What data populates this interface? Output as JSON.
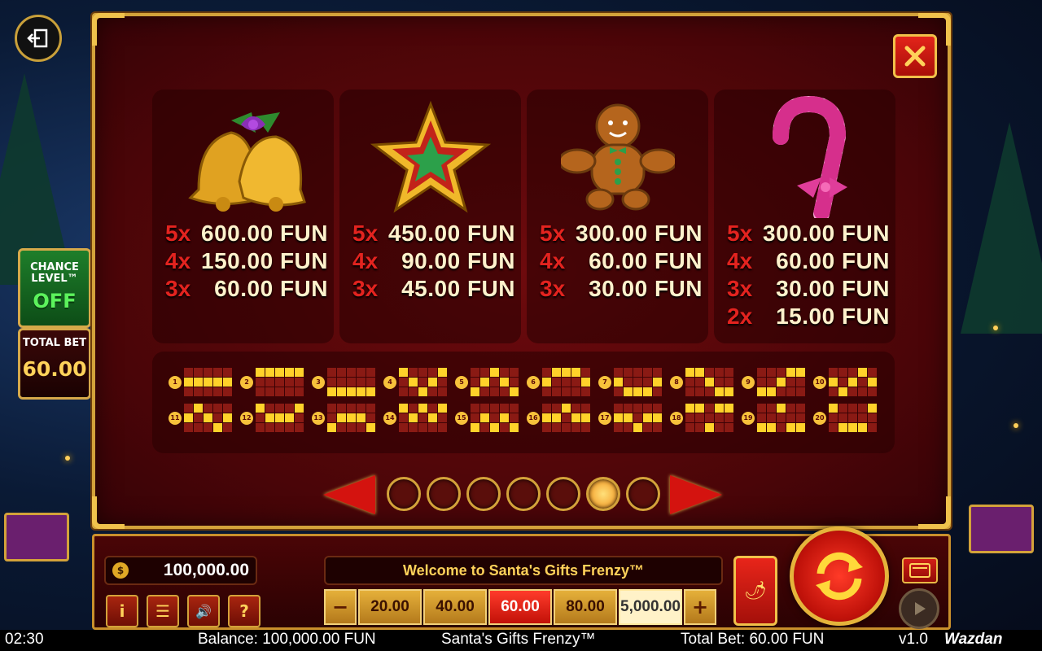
{
  "side": {
    "chance_label": "CHANCE LEVEL™",
    "chance_value": "OFF",
    "total_bet_label": "TOTAL BET",
    "total_bet_value": "60.00"
  },
  "paytable": {
    "symbols": [
      {
        "name": "bells",
        "icon": "bells-icon",
        "pays": [
          {
            "count": "5x",
            "amount": "600.00 FUN"
          },
          {
            "count": "4x",
            "amount": "150.00 FUN"
          },
          {
            "count": "3x",
            "amount": "60.00 FUN"
          }
        ]
      },
      {
        "name": "star",
        "icon": "star-icon",
        "pays": [
          {
            "count": "5x",
            "amount": "450.00 FUN"
          },
          {
            "count": "4x",
            "amount": "90.00 FUN"
          },
          {
            "count": "3x",
            "amount": "45.00 FUN"
          }
        ]
      },
      {
        "name": "gingerbread",
        "icon": "gingerbread-man-icon",
        "pays": [
          {
            "count": "5x",
            "amount": "300.00 FUN"
          },
          {
            "count": "4x",
            "amount": "60.00 FUN"
          },
          {
            "count": "3x",
            "amount": "30.00 FUN"
          }
        ]
      },
      {
        "name": "candy-cane",
        "icon": "candy-cane-icon",
        "pays": [
          {
            "count": "5x",
            "amount": "300.00 FUN"
          },
          {
            "count": "4x",
            "amount": "60.00 FUN"
          },
          {
            "count": "3x",
            "amount": "30.00 FUN"
          },
          {
            "count": "2x",
            "amount": "15.00 FUN"
          }
        ]
      }
    ],
    "paylines": [
      {
        "n": "1",
        "rows": [
          1,
          1,
          1,
          1,
          1
        ]
      },
      {
        "n": "2",
        "rows": [
          0,
          0,
          0,
          0,
          0
        ]
      },
      {
        "n": "3",
        "rows": [
          2,
          2,
          2,
          2,
          2
        ]
      },
      {
        "n": "4",
        "rows": [
          0,
          1,
          2,
          1,
          0
        ]
      },
      {
        "n": "5",
        "rows": [
          2,
          1,
          0,
          1,
          2
        ]
      },
      {
        "n": "6",
        "rows": [
          1,
          0,
          0,
          0,
          1
        ]
      },
      {
        "n": "7",
        "rows": [
          1,
          2,
          2,
          2,
          1
        ]
      },
      {
        "n": "8",
        "rows": [
          0,
          0,
          1,
          2,
          2
        ]
      },
      {
        "n": "9",
        "rows": [
          2,
          2,
          1,
          0,
          0
        ]
      },
      {
        "n": "10",
        "rows": [
          1,
          2,
          1,
          0,
          1
        ]
      },
      {
        "n": "11",
        "rows": [
          1,
          0,
          1,
          2,
          1
        ]
      },
      {
        "n": "12",
        "rows": [
          0,
          1,
          1,
          1,
          0
        ]
      },
      {
        "n": "13",
        "rows": [
          2,
          1,
          1,
          1,
          2
        ]
      },
      {
        "n": "14",
        "rows": [
          0,
          1,
          0,
          1,
          0
        ]
      },
      {
        "n": "15",
        "rows": [
          2,
          1,
          2,
          1,
          2
        ]
      },
      {
        "n": "16",
        "rows": [
          1,
          1,
          0,
          1,
          1
        ]
      },
      {
        "n": "17",
        "rows": [
          1,
          1,
          2,
          1,
          1
        ]
      },
      {
        "n": "18",
        "rows": [
          0,
          0,
          2,
          0,
          0
        ]
      },
      {
        "n": "19",
        "rows": [
          2,
          2,
          0,
          2,
          2
        ]
      },
      {
        "n": "20",
        "rows": [
          0,
          2,
          2,
          2,
          0
        ]
      }
    ],
    "pages": 7,
    "active_page": 6
  },
  "controls": {
    "balance": "100,000.00",
    "welcome": "Welcome to Santa's Gifts Frenzy™",
    "minus": "−",
    "plus": "+",
    "bets": [
      "20.00",
      "40.00",
      "60.00",
      "80.00",
      "5,000.00"
    ],
    "active_bet_index": 2,
    "info_label": "i",
    "menu_label": "☰",
    "sound_label": "🔊",
    "help_label": "?"
  },
  "status": {
    "time": "02:30",
    "balance": "Balance: 100,000.00 FUN",
    "game": "Santa's Gifts Frenzy™",
    "total_bet": "Total Bet: 60.00 FUN",
    "version": "v1.0",
    "brand": "Wazdan"
  },
  "colors": {
    "accent_gold": "#d3a23a",
    "panel_red": "#4a0508",
    "pay_count_red": "#e3231f",
    "line_on": "#ffd22a"
  }
}
